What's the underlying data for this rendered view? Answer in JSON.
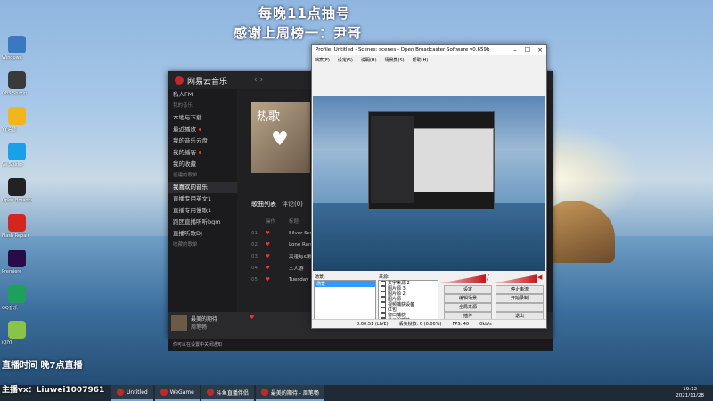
{
  "banner": {
    "line1": "每晚11点抽号",
    "line2": "感谢上周榜一：尹哥"
  },
  "desktop": {
    "left_icons": [
      {
        "label": "Windows",
        "color": "#3a78c2"
      },
      {
        "label": "OBS Studio",
        "color": "#3a3a3a"
      },
      {
        "label": "YY语音",
        "color": "#f2b51c"
      },
      {
        "label": "Ve Studio",
        "color": "#19a0e8"
      },
      {
        "label": "Open Broadcaster",
        "color": "#222"
      },
      {
        "label": "Flash Repair",
        "color": "#d3261f"
      },
      {
        "label": "Premiere",
        "color": "#2a0b4a"
      },
      {
        "label": "QQ音乐",
        "color": "#1da05b"
      },
      {
        "label": "iQIYI",
        "color": "#8ac34a"
      }
    ]
  },
  "music": {
    "app_name": "网易云音乐",
    "sidebar": [
      {
        "label": "私人FM",
        "type": "item"
      },
      {
        "label": "我的音乐",
        "type": "section"
      },
      {
        "label": "本地与下载",
        "type": "item"
      },
      {
        "label": "最近播放",
        "type": "item",
        "dot": true
      },
      {
        "label": "我的音乐云盘",
        "type": "item"
      },
      {
        "label": "我的播客",
        "type": "item",
        "dot": true
      },
      {
        "label": "我的收藏",
        "type": "item"
      },
      {
        "label": "创建的歌单",
        "type": "section"
      },
      {
        "label": "我喜欢的音乐",
        "type": "item",
        "active": true
      },
      {
        "label": "直播专用英文1",
        "type": "item"
      },
      {
        "label": "直播专用慢歌1",
        "type": "item"
      },
      {
        "label": "跑团直播听听bgm",
        "type": "item"
      },
      {
        "label": "直播听歌DJ",
        "type": "item"
      },
      {
        "label": "收藏的歌单",
        "type": "section"
      }
    ],
    "album_text": "热歌",
    "tabs": [
      "歌曲列表",
      "评论(0)"
    ],
    "columns": [
      "操作",
      "标题"
    ],
    "rows": [
      {
        "no": "01",
        "title": "Silver Scrape"
      },
      {
        "no": "02",
        "title": "Lone Ranger"
      },
      {
        "no": "03",
        "title": "高速与&教室"
      },
      {
        "no": "04",
        "title": "三人游"
      },
      {
        "no": "05",
        "title": "Tuesday"
      }
    ],
    "footer": {
      "song": "最美的期待",
      "artist": "周笔畅",
      "hint": "你可以在设置中关闭通知"
    }
  },
  "obs": {
    "title": "Profile: Untitled - Scenes: scenes - Open Broadcaster Software v0.659b",
    "menus": [
      "档案(F)",
      "设定(S)",
      "说明(H)",
      "场景集(S)",
      "帮助(H)"
    ],
    "scenes_label": "场景:",
    "sources_label": "来源:",
    "scene_items": [
      "场景"
    ],
    "sources": [
      "文字来源 2",
      "图片源 3",
      "图片源 2",
      "图片源",
      "视频捕获设备",
      "红包",
      "窗口捕获",
      "显示器捕获"
    ],
    "buttons": [
      "设定",
      "停止串流",
      "编辑场景",
      "开始录制",
      "全局来源",
      "",
      "插件",
      "退出"
    ],
    "status": [
      "0:00:51 (LIVE)",
      "丢失帧数: 0 (0.00%)",
      "FPS: 40",
      "0kb/s"
    ]
  },
  "taskbar": {
    "items": [
      "Untitled",
      "WeGame",
      "斗鱼直播伴侣",
      "最美的期待 - 周笔畅"
    ],
    "time": "19:12",
    "date": "2021/11/28"
  },
  "overlay": {
    "stream_text": "直播时间 晚7点直播",
    "contact": "主播vx：Liuwei1007961"
  }
}
